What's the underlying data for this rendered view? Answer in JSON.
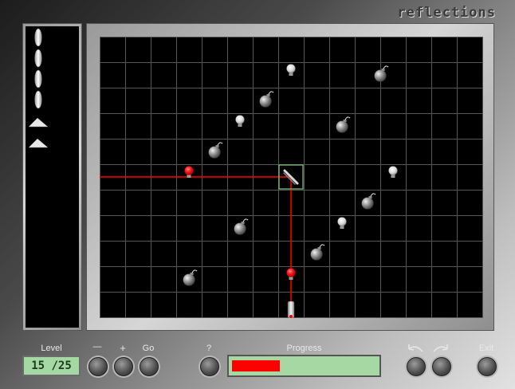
{
  "app": {
    "brand": "reflections"
  },
  "board": {
    "cols": 15,
    "rows": 11
  },
  "inventory": {
    "items": [
      {
        "type": "round-mirror"
      },
      {
        "type": "round-mirror"
      },
      {
        "type": "round-mirror"
      },
      {
        "type": "round-mirror"
      },
      {
        "type": "flat-mirror"
      },
      {
        "type": "flat-mirror"
      }
    ]
  },
  "bombs": [
    {
      "col": 10.5,
      "row": 1
    },
    {
      "col": 6,
      "row": 2
    },
    {
      "col": 9,
      "row": 3
    },
    {
      "col": 4,
      "row": 4
    },
    {
      "col": 10,
      "row": 6
    },
    {
      "col": 5,
      "row": 7
    },
    {
      "col": 8,
      "row": 8
    },
    {
      "col": 3,
      "row": 9
    }
  ],
  "bulbs": [
    {
      "col": 7,
      "row": 0.75,
      "lit": false
    },
    {
      "col": 5,
      "row": 2.75,
      "lit": false
    },
    {
      "col": 11,
      "row": 4.75,
      "lit": false
    },
    {
      "col": 9,
      "row": 6.75,
      "lit": false
    },
    {
      "col": 3,
      "row": 4.75,
      "lit": true
    },
    {
      "col": 7,
      "row": 8.75,
      "lit": true
    }
  ],
  "laser_source": {
    "col": 7,
    "row": 10.25
  },
  "mirror": {
    "col": 7,
    "row": 5
  },
  "beam": [
    [
      7,
      10.25
    ],
    [
      7,
      5
    ],
    [
      0,
      5
    ]
  ],
  "controls": {
    "level_label": "Level",
    "level_value": "15 /25",
    "minus_label": "—",
    "plus_label": "+",
    "go_label": "Go",
    "help_label": "?",
    "progress_label": "Progress",
    "progress": 0.33,
    "exit_label": "Exit"
  },
  "colors": {
    "beam": "#ff0000",
    "progress": "#ff0000",
    "display": "#a6d8a4",
    "selection": "#7fc77f"
  }
}
